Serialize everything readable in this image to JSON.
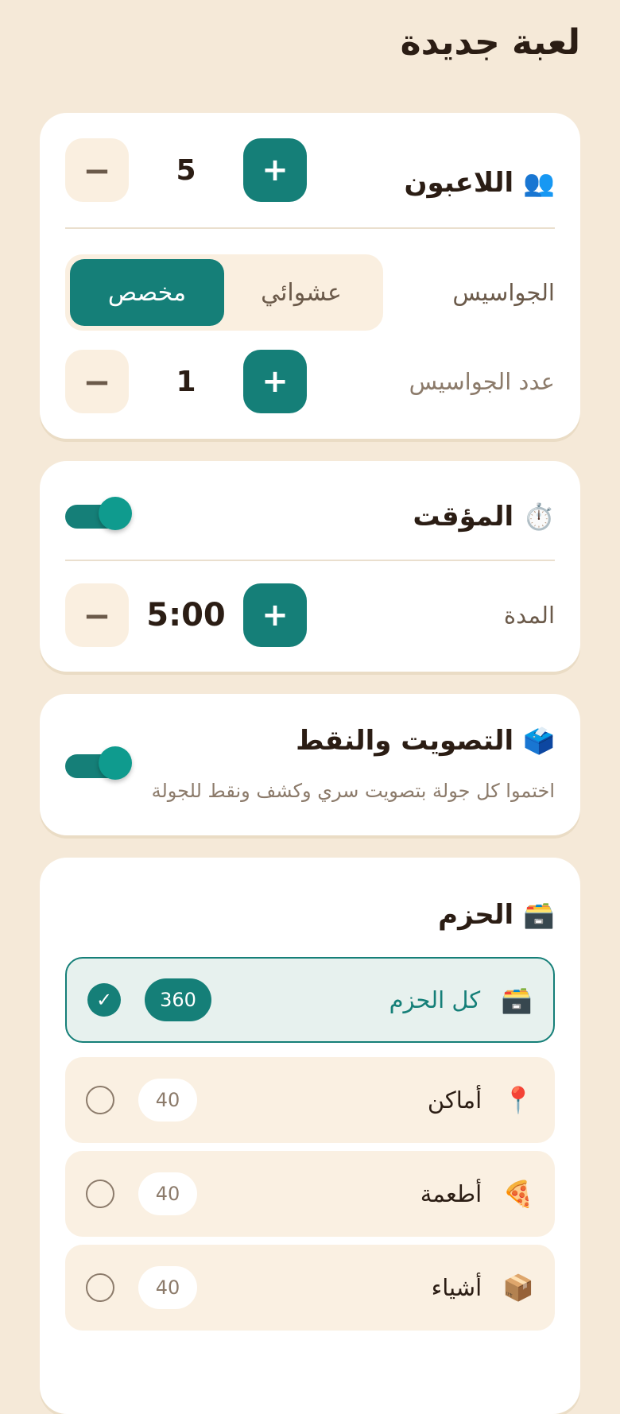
{
  "page": {
    "title": "لعبة جديدة"
  },
  "players_card": {
    "title": "اللاعبون",
    "icon": "👥",
    "count": "5",
    "spies_label": "الجواسيس",
    "spies_mode_options": [
      "عشوائي",
      "مخصص"
    ],
    "spies_mode_selected": "مخصص",
    "spy_count_label": "عدد الجواسيس",
    "spy_count": "1",
    "plus": "+",
    "minus": "−"
  },
  "timer_card": {
    "title": "المؤقت",
    "icon": "⏱️",
    "enabled": true,
    "duration_label": "المدة",
    "duration": "5:00"
  },
  "voting_card": {
    "title": "التصويت والنقط",
    "icon": "🗳️",
    "description": "اختموا كل جولة بتصويت سري وكشف ونقط للجولة",
    "enabled": true
  },
  "packs_card": {
    "title": "الحزم",
    "icon": "🗃️",
    "packs": [
      {
        "name": "كل الحزم",
        "icon": "🗃️",
        "count": "360",
        "selected": true
      },
      {
        "name": "أماكن",
        "icon": "📍",
        "count": "40",
        "selected": false
      },
      {
        "name": "أطعمة",
        "icon": "🍕",
        "count": "40",
        "selected": false
      },
      {
        "name": "أشياء",
        "icon": "📦",
        "count": "40",
        "selected": false
      }
    ]
  },
  "colors": {
    "accent": "#157f78",
    "background": "#f5e9d8",
    "card": "#ffffff"
  }
}
